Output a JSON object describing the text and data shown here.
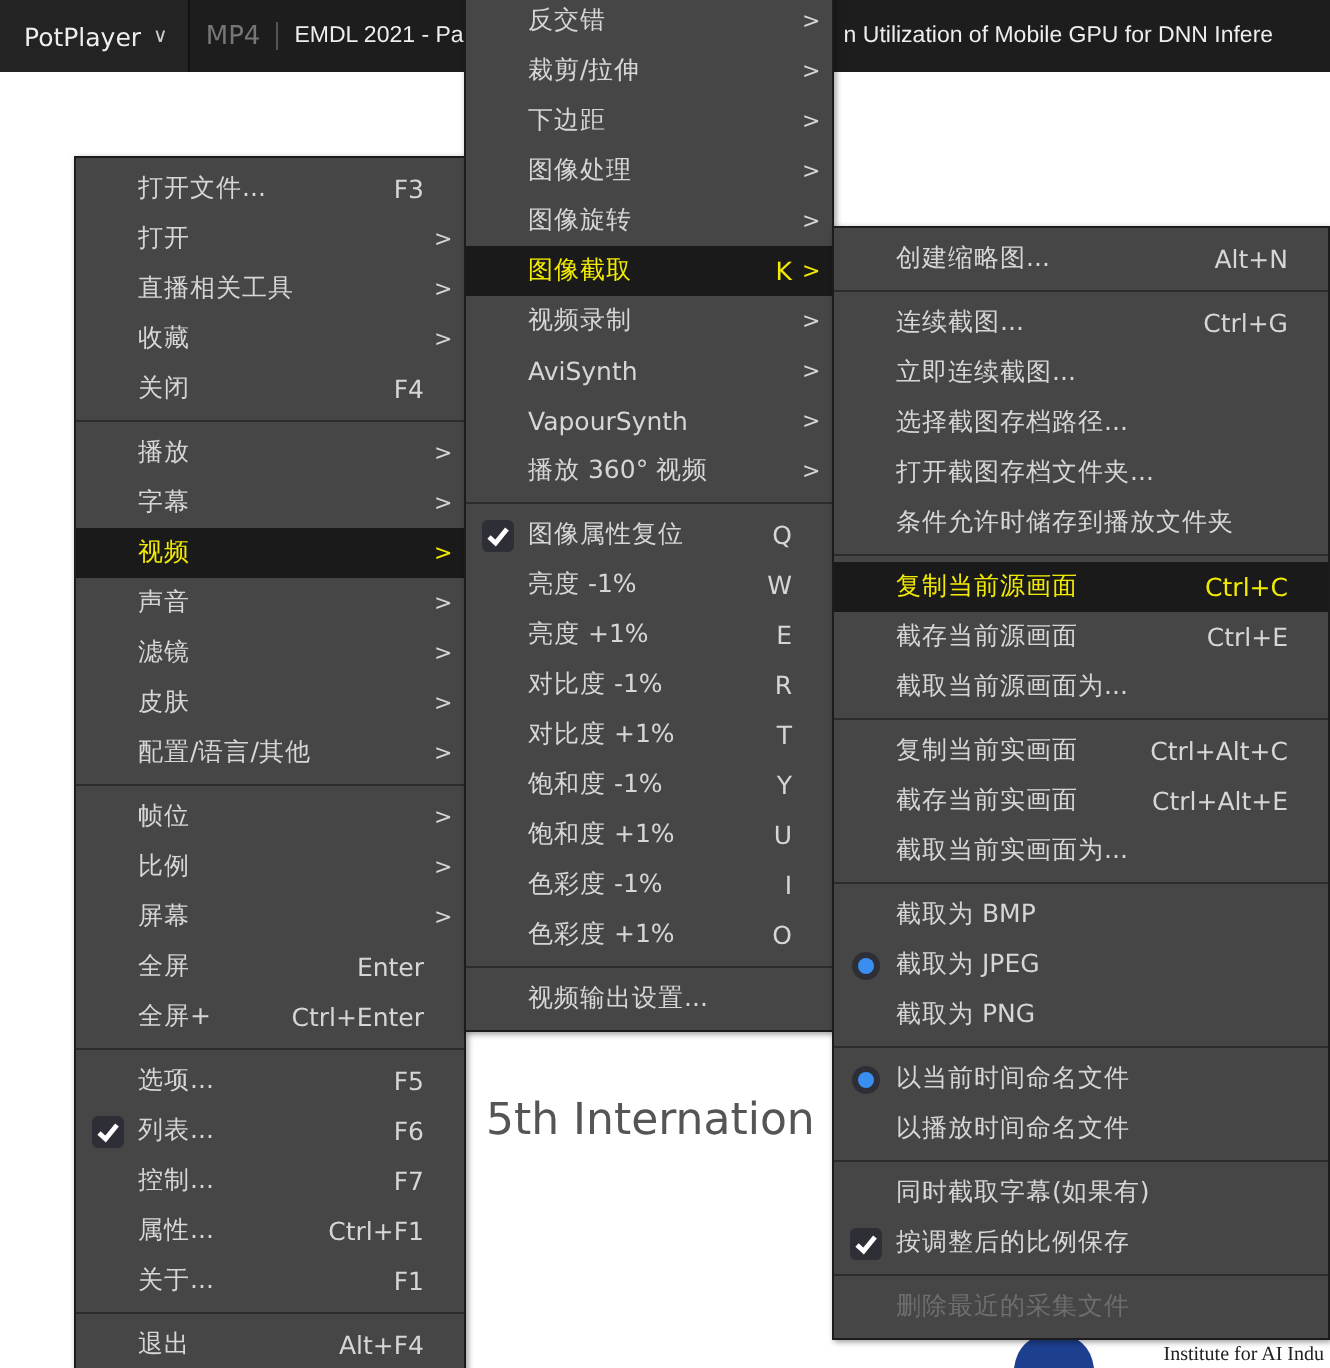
{
  "app_button": {
    "label": "PotPlayer",
    "caret": "∨"
  },
  "tab_format": "MP4",
  "title_parts": [
    "EMDL 2021 - Pa",
    "n Utilization of Mobile GPU for DNN Infere"
  ],
  "slide": {
    "heading": "5th Internation",
    "logo_caption": "Institute for AI Indu"
  },
  "menus": [
    {
      "items": [
        {
          "kind": "item",
          "label": "打开文件...",
          "shortcut": "F3",
          "selected": false
        },
        {
          "kind": "item",
          "label": "打开",
          "arrow": ">",
          "selected": false
        },
        {
          "kind": "item",
          "label": "直播相关工具",
          "arrow": ">",
          "selected": false
        },
        {
          "kind": "item",
          "label": "收藏",
          "arrow": ">",
          "selected": false
        },
        {
          "kind": "item",
          "label": "关闭",
          "shortcut": "F4",
          "selected": false
        },
        {
          "kind": "separator"
        },
        {
          "kind": "item",
          "label": "播放",
          "arrow": ">",
          "selected": false
        },
        {
          "kind": "item",
          "label": "字幕",
          "arrow": ">",
          "selected": false
        },
        {
          "kind": "item",
          "label": "视频",
          "arrow": ">",
          "selected": true
        },
        {
          "kind": "item",
          "label": "声音",
          "arrow": ">",
          "selected": false
        },
        {
          "kind": "item",
          "label": "滤镜",
          "arrow": ">",
          "selected": false
        },
        {
          "kind": "item",
          "label": "皮肤",
          "arrow": ">",
          "selected": false
        },
        {
          "kind": "item",
          "label": "配置/语言/其他",
          "arrow": ">",
          "selected": false
        },
        {
          "kind": "separator"
        },
        {
          "kind": "item",
          "label": "帧位",
          "arrow": ">",
          "selected": false
        },
        {
          "kind": "item",
          "label": "比例",
          "arrow": ">",
          "selected": false
        },
        {
          "kind": "item",
          "label": "屏幕",
          "arrow": ">",
          "selected": false
        },
        {
          "kind": "item",
          "label": "全屏",
          "shortcut": "Enter",
          "selected": false
        },
        {
          "kind": "item",
          "label": "全屏+",
          "shortcut": "Ctrl+Enter",
          "selected": false
        },
        {
          "kind": "separator"
        },
        {
          "kind": "item",
          "label": "选项...",
          "shortcut": "F5",
          "selected": false
        },
        {
          "kind": "check",
          "label": "列表...",
          "shortcut": "F6",
          "checked": true,
          "selected": false
        },
        {
          "kind": "item",
          "label": "控制...",
          "shortcut": "F7",
          "selected": false
        },
        {
          "kind": "item",
          "label": "属性...",
          "shortcut": "Ctrl+F1",
          "selected": false
        },
        {
          "kind": "item",
          "label": "关于...",
          "shortcut": "F1",
          "selected": false
        },
        {
          "kind": "separator"
        },
        {
          "kind": "item",
          "label": "退出",
          "shortcut": "Alt+F4",
          "selected": false
        }
      ]
    },
    {
      "items": [
        {
          "kind": "item",
          "label": "反交错",
          "arrow": ">",
          "selected": false
        },
        {
          "kind": "item",
          "label": "裁剪/拉伸",
          "arrow": ">",
          "selected": false
        },
        {
          "kind": "item",
          "label": "下边距",
          "arrow": ">",
          "selected": false
        },
        {
          "kind": "item",
          "label": "图像处理",
          "arrow": ">",
          "selected": false
        },
        {
          "kind": "item",
          "label": "图像旋转",
          "arrow": ">",
          "selected": false
        },
        {
          "kind": "item",
          "label": "图像截取",
          "shortcut": "K",
          "arrow": ">",
          "selected": true
        },
        {
          "kind": "item",
          "label": "视频录制",
          "arrow": ">",
          "selected": false
        },
        {
          "kind": "item",
          "label": "AviSynth",
          "arrow": ">",
          "selected": false
        },
        {
          "kind": "item",
          "label": "VapourSynth",
          "arrow": ">",
          "selected": false
        },
        {
          "kind": "item",
          "label": "播放 360° 视频",
          "arrow": ">",
          "selected": false
        },
        {
          "kind": "separator"
        },
        {
          "kind": "check",
          "label": "图像属性复位",
          "shortcut": "Q",
          "checked": true,
          "selected": false
        },
        {
          "kind": "item",
          "label": "亮度 -1%",
          "shortcut": "W",
          "selected": false
        },
        {
          "kind": "item",
          "label": "亮度 +1%",
          "shortcut": "E",
          "selected": false
        },
        {
          "kind": "item",
          "label": "对比度 -1%",
          "shortcut": "R",
          "selected": false
        },
        {
          "kind": "item",
          "label": "对比度 +1%",
          "shortcut": "T",
          "selected": false
        },
        {
          "kind": "item",
          "label": "饱和度 -1%",
          "shortcut": "Y",
          "selected": false
        },
        {
          "kind": "item",
          "label": "饱和度 +1%",
          "shortcut": "U",
          "selected": false
        },
        {
          "kind": "item",
          "label": "色彩度 -1%",
          "shortcut": "I",
          "selected": false
        },
        {
          "kind": "item",
          "label": "色彩度 +1%",
          "shortcut": "O",
          "selected": false
        },
        {
          "kind": "separator"
        },
        {
          "kind": "item",
          "label": "视频输出设置...",
          "selected": false
        }
      ]
    },
    {
      "items": [
        {
          "kind": "item",
          "label": "创建缩略图...",
          "shortcut": "Alt+N",
          "selected": false
        },
        {
          "kind": "separator"
        },
        {
          "kind": "item",
          "label": "连续截图...",
          "shortcut": "Ctrl+G",
          "selected": false
        },
        {
          "kind": "item",
          "label": "立即连续截图...",
          "selected": false
        },
        {
          "kind": "item",
          "label": "选择截图存档路径...",
          "selected": false
        },
        {
          "kind": "item",
          "label": "打开截图存档文件夹...",
          "selected": false
        },
        {
          "kind": "item",
          "label": "条件允许时储存到播放文件夹",
          "selected": false
        },
        {
          "kind": "separator"
        },
        {
          "kind": "item",
          "label": "复制当前源画面",
          "shortcut": "Ctrl+C",
          "selected": true
        },
        {
          "kind": "item",
          "label": "截存当前源画面",
          "shortcut": "Ctrl+E",
          "selected": false
        },
        {
          "kind": "item",
          "label": "截取当前源画面为...",
          "selected": false
        },
        {
          "kind": "separator"
        },
        {
          "kind": "item",
          "label": "复制当前实画面",
          "shortcut": "Ctrl+Alt+C",
          "selected": false
        },
        {
          "kind": "item",
          "label": "截存当前实画面",
          "shortcut": "Ctrl+Alt+E",
          "selected": false
        },
        {
          "kind": "item",
          "label": "截取当前实画面为...",
          "selected": false
        },
        {
          "kind": "separator"
        },
        {
          "kind": "radio",
          "label": "截取为 BMP",
          "checked": false,
          "selected": false
        },
        {
          "kind": "radio",
          "label": "截取为 JPEG",
          "checked": true,
          "selected": false
        },
        {
          "kind": "radio",
          "label": "截取为 PNG",
          "checked": false,
          "selected": false
        },
        {
          "kind": "separator"
        },
        {
          "kind": "radio",
          "label": "以当前时间命名文件",
          "checked": true,
          "selected": false
        },
        {
          "kind": "radio",
          "label": "以播放时间命名文件",
          "checked": false,
          "selected": false
        },
        {
          "kind": "separator"
        },
        {
          "kind": "check",
          "label": "同时截取字幕(如果有)",
          "checked": false,
          "selected": false
        },
        {
          "kind": "check",
          "label": "按调整后的比例保存",
          "checked": true,
          "selected": false
        },
        {
          "kind": "separator"
        },
        {
          "kind": "item",
          "label": "删除最近的采集文件",
          "disabled": true,
          "selected": false
        }
      ]
    }
  ]
}
